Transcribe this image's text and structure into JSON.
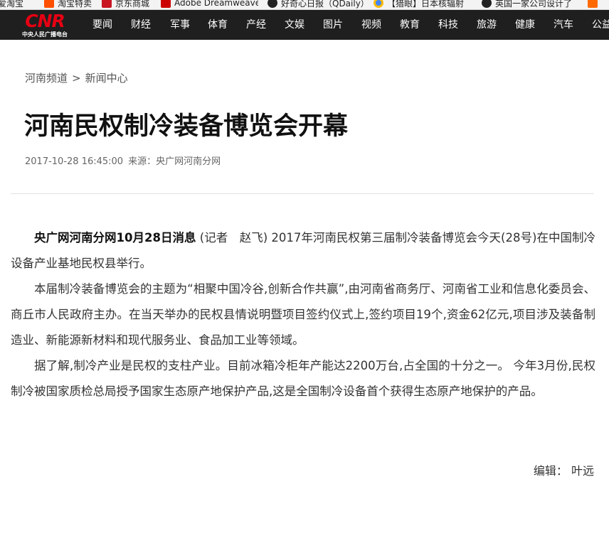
{
  "bookmarks": [
    {
      "label": "爱淘宝",
      "icon": "taobao-icon",
      "color": "#ff5000"
    },
    {
      "label": "淘宝特卖",
      "icon": "taobao-sale-icon",
      "color": "#ff5000"
    },
    {
      "label": "京东商城",
      "icon": "jd-icon",
      "color": "#c81623"
    },
    {
      "label": "Adobe Dreamweaver",
      "icon": "adobe-icon",
      "color": "#cc0000"
    },
    {
      "label": "好奇心日报（QDaily）",
      "icon": "qdaily-icon",
      "color": "#222222"
    },
    {
      "label": "【猎眼】日本核辐射",
      "icon": "chrome-icon",
      "color": "#4285f4"
    },
    {
      "label": "英国一家公司设计了",
      "icon": "qdaily-icon-2",
      "color": "#222222"
    }
  ],
  "logo": {
    "main": "CNR",
    "sub": "中央人民广播电台"
  },
  "nav": [
    "要闻",
    "财经",
    "军事",
    "体育",
    "产经",
    "文娱",
    "图片",
    "视频",
    "教育",
    "科技",
    "旅游",
    "健康",
    "汽车",
    "公益"
  ],
  "breadcrumb": {
    "channel": "河南频道",
    "separator": ">",
    "section": "新闻中心"
  },
  "article": {
    "title": "河南民权制冷装备博览会开幕",
    "datetime": "2017-10-28 16:45:00",
    "source": "来源：央广网河南分网",
    "lead": "央广网河南分网10月28日消息",
    "p1_rest": " (记者　赵飞) 2017年河南民权第三届制冷装备博览会今天(28号)在中国制冷设备产业基地民权县举行。",
    "p2": "本届制冷装备博览会的主题为“相聚中国冷谷,创新合作共赢”,由河南省商务厅、河南省工业和信息化委员会、商丘市人民政府主办。在当天举办的民权县情说明暨项目签约仪式上,签约项目19个,资金62亿元,项目涉及装备制造业、新能源新材料和现代服务业、食品加工业等领域。",
    "p3": "据了解,制冷产业是民权的支柱产业。目前冰箱冷柜年产能达2200万台,占全国的十分之一。 今年3月份,民权制冷被国家质检总局授予国家生态原产地保护产品,这是全国制冷设备首个获得生态原产地保护的产品。",
    "editor": "编辑：  叶远"
  },
  "colors": {
    "nav_bg": "#1f1f1f",
    "logo_red": "#e60012",
    "title": "#111111",
    "meta": "#666666"
  }
}
